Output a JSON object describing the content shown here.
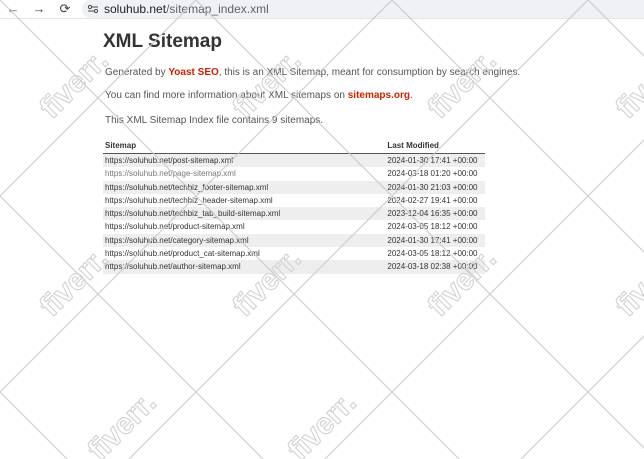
{
  "browser": {
    "url_domain": "soluhub.net",
    "url_path": "/sitemap_index.xml",
    "back_icon": "←",
    "forward_icon": "→",
    "reload_icon": "⟳"
  },
  "page": {
    "title": "XML Sitemap",
    "generated_prefix": "Generated by ",
    "generator_link": "Yoast SEO",
    "generated_suffix": ", this is an XML Sitemap, meant for consumption by search engines.",
    "more_info_prefix": "You can find more information about XML sitemaps on ",
    "more_info_link": "sitemaps.org",
    "more_info_suffix": ".",
    "count_text": "This XML Sitemap Index file contains 9 sitemaps."
  },
  "table": {
    "headers": {
      "sitemap": "Sitemap",
      "modified": "Last Modified"
    },
    "rows": [
      {
        "loc": "https://soluhub.net/post-sitemap.xml",
        "modified": "2024-01-30 17:41 +00:00"
      },
      {
        "loc": "https://soluhub.net/page-sitemap.xml",
        "modified": "2024-03-18 01:20 +00:00"
      },
      {
        "loc": "https://soluhub.net/techbiz_footer-sitemap.xml",
        "modified": "2024-01-30 21:03 +00:00"
      },
      {
        "loc": "https://soluhub.net/techbiz_header-sitemap.xml",
        "modified": "2024-02-27 19:41 +00:00"
      },
      {
        "loc": "https://soluhub.net/techbiz_tab_build-sitemap.xml",
        "modified": "2023-12-04 16:35 +00:00"
      },
      {
        "loc": "https://soluhub.net/product-sitemap.xml",
        "modified": "2024-03-05 18:12 +00:00"
      },
      {
        "loc": "https://soluhub.net/category-sitemap.xml",
        "modified": "2024-01-30 17:41 +00:00"
      },
      {
        "loc": "https://soluhub.net/product_cat-sitemap.xml",
        "modified": "2024-03-05 18:12 +00:00"
      },
      {
        "loc": "https://soluhub.net/author-sitemap.xml",
        "modified": "2024-03-18 02:38 +00:00"
      }
    ]
  },
  "watermark": {
    "text": "fiverr."
  },
  "colors": {
    "link_accent": "#cc2200",
    "row_alt": "#eeeeee"
  }
}
